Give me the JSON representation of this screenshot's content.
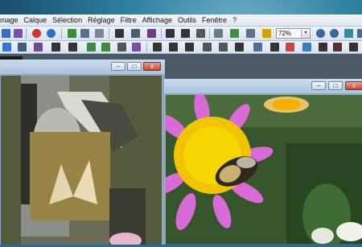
{
  "menubar": {
    "items": [
      "mage",
      "Calque",
      "Sélection",
      "Réglage",
      "Filtre",
      "Affichage",
      "Outils",
      "Fenêtre",
      "?"
    ]
  },
  "toolbar": {
    "zoom_value": "72%",
    "zoom_arrow": "▾"
  },
  "windows": {
    "left": {
      "min": "–",
      "max": "□",
      "close": "x"
    },
    "right": {
      "min": "–",
      "max": "□",
      "close": "x"
    }
  },
  "colors": {
    "menubar_bg": "#e6edf5",
    "workspace_bg": "#4d5a66",
    "window_title": "#b6cde4"
  }
}
